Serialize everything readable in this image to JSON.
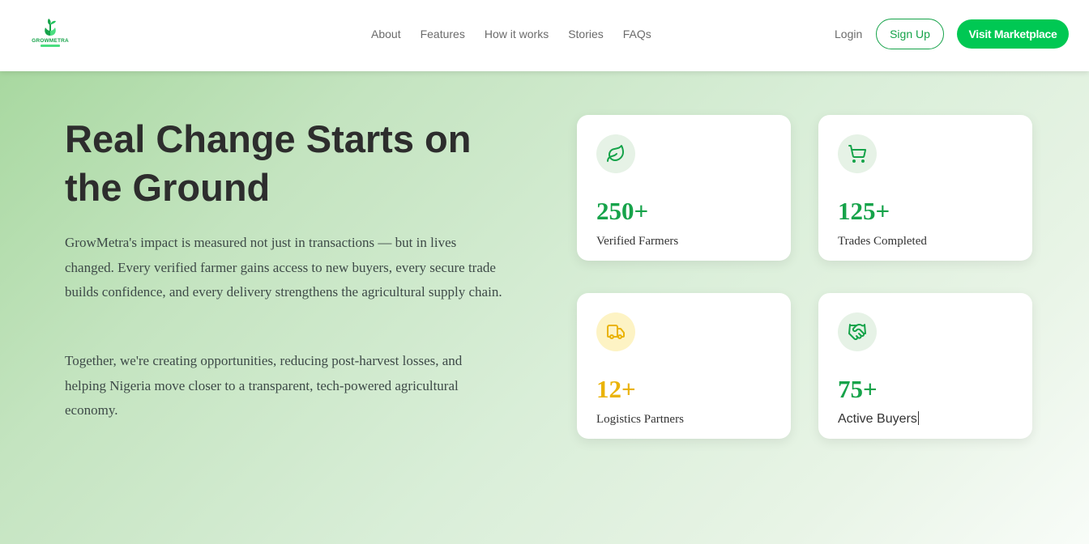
{
  "brand": {
    "name": "GROWMETRA",
    "color": "#16a34a"
  },
  "nav": {
    "items": [
      "About",
      "Features",
      "How it works",
      "Stories",
      "FAQs"
    ]
  },
  "auth": {
    "login": "Login",
    "signup": "Sign Up",
    "marketplace": "Visit Marketplace"
  },
  "hero": {
    "title": "Real Change Starts on the Ground",
    "paragraphs": [
      "GrowMetra's impact is measured not just in transactions — but in lives changed. Every verified farmer gains access to new buyers, every secure trade builds confidence, and every delivery strengthens the agricultural supply chain.",
      "Together, we're creating opportunities, reducing post-harvest losses, and helping Nigeria move closer to a transparent, tech-powered agricultural economy."
    ]
  },
  "stats": [
    {
      "value": "250+",
      "label": "Verified Farmers",
      "icon": "leaf-icon",
      "color": "#16a34a"
    },
    {
      "value": "125+",
      "label": "Trades Completed",
      "icon": "cart-icon",
      "color": "#16a34a"
    },
    {
      "value": "12+",
      "label": "Logistics Partners",
      "icon": "truck-icon",
      "color": "#eab308"
    },
    {
      "value": "75+",
      "label": "Active Buyers",
      "icon": "handshake-icon",
      "color": "#16a34a"
    }
  ]
}
